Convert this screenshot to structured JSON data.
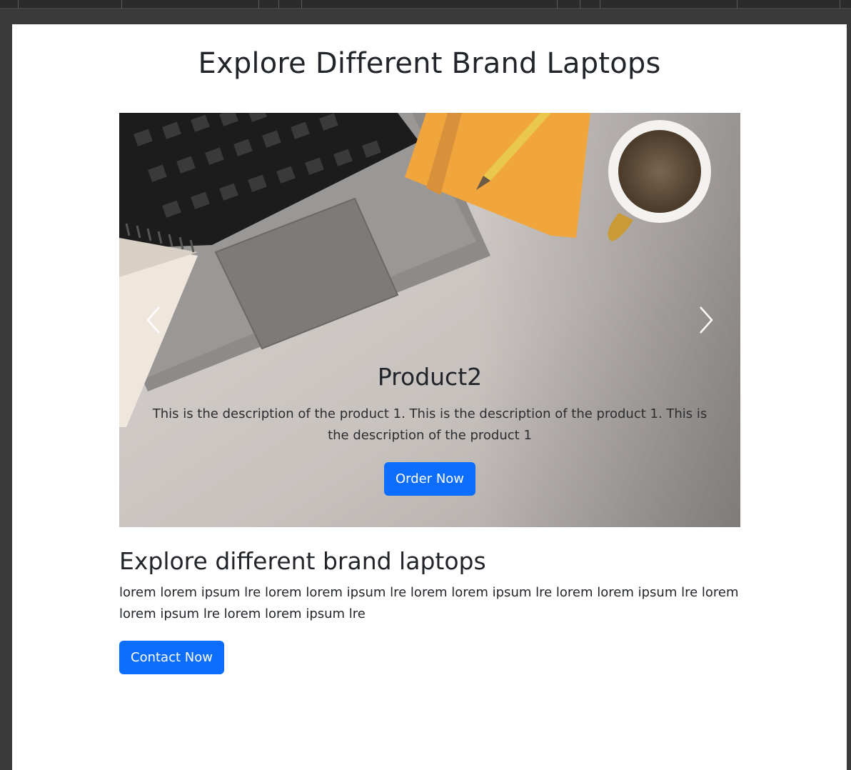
{
  "page": {
    "title": "Explore Different Brand Laptops"
  },
  "carousel": {
    "slide_title": "Product2",
    "slide_description": "This is the description of the product 1. This is the description of the product 1. This is the description of the product 1",
    "order_button_label": "Order Now",
    "prev_icon": "chevron-left-icon",
    "next_icon": "chevron-right-icon"
  },
  "section": {
    "title": "Explore different brand laptops",
    "text": "lorem lorem ipsum lre lorem lorem ipsum lre lorem lorem ipsum lre lorem lorem ipsum lre lorem lorem ipsum lre lorem lorem ipsum lre",
    "contact_button_label": "Contact Now"
  },
  "colors": {
    "primary": "#0d6efd",
    "text": "#212529",
    "background": "#ffffff",
    "frame": "#3a3a3a"
  }
}
